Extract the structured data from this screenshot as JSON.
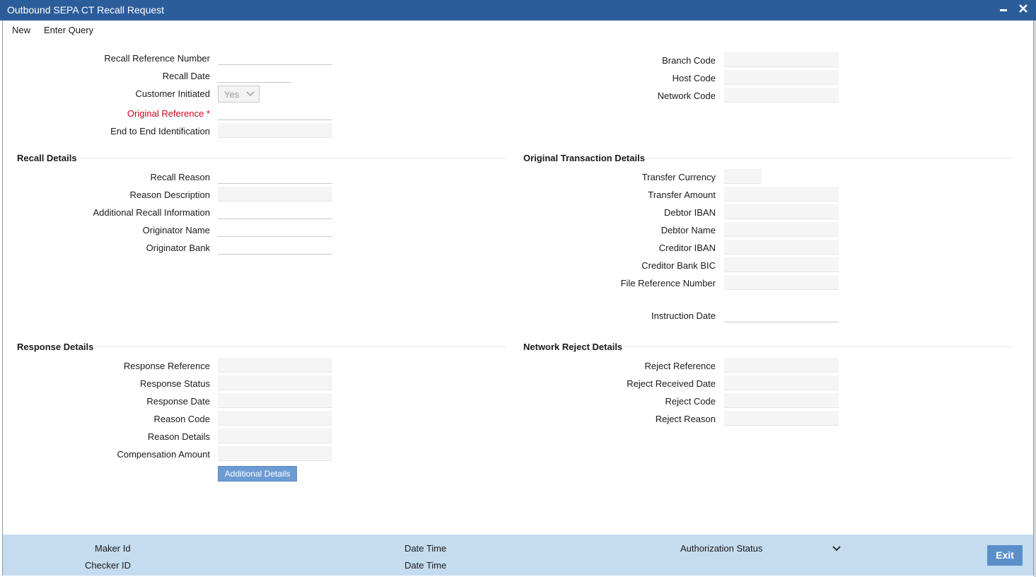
{
  "window": {
    "title": "Outbound SEPA CT Recall Request",
    "minimize_icon": "minimize-icon",
    "close_icon": "close-icon"
  },
  "menu": {
    "new": "New",
    "enter_query": "Enter Query"
  },
  "header": {
    "recall_reference_number": "Recall Reference Number",
    "recall_date": "Recall Date",
    "customer_initiated": "Customer Initiated",
    "customer_initiated_value": "Yes",
    "original_reference": "Original Reference",
    "required_mark": "*",
    "end_to_end_identification": "End to End Identification",
    "branch_code": "Branch Code",
    "host_code": "Host Code",
    "network_code": "Network Code"
  },
  "recall_details": {
    "title": "Recall Details",
    "recall_reason": "Recall Reason",
    "reason_description": "Reason Description",
    "additional_recall_information": "Additional Recall Information",
    "originator_name": "Originator Name",
    "originator_bank": "Originator Bank"
  },
  "original_transaction_details": {
    "title": "Original Transaction Details",
    "transfer_currency": "Transfer Currency",
    "transfer_amount": "Transfer Amount",
    "debtor_iban": "Debtor IBAN",
    "debtor_name": "Debtor Name",
    "creditor_iban": "Creditor IBAN",
    "creditor_bank_bic": "Creditor Bank BIC",
    "file_reference_number": "File Reference Number",
    "instruction_date": "Instruction Date"
  },
  "response_details": {
    "title": "Response Details",
    "response_reference": "Response Reference",
    "response_status": "Response Status",
    "response_date": "Response Date",
    "reason_code": "Reason Code",
    "reason_details": "Reason Details",
    "compensation_amount": "Compensation Amount",
    "additional_details_button": "Additional Details"
  },
  "network_reject_details": {
    "title": "Network Reject Details",
    "reject_reference": "Reject Reference",
    "reject_received_date": "Reject Received Date",
    "reject_code": "Reject Code",
    "reject_reason": "Reject Reason"
  },
  "footer": {
    "maker_id": "Maker Id",
    "checker_id": "Checker ID",
    "date_time_1": "Date Time",
    "date_time_2": "Date Time",
    "authorization_status": "Authorization Status",
    "exit": "Exit"
  },
  "colors": {
    "title_bar": "#2c5d9b",
    "footer": "#c5dcef",
    "required": "#d0021b",
    "button": "#6b9bd3"
  }
}
